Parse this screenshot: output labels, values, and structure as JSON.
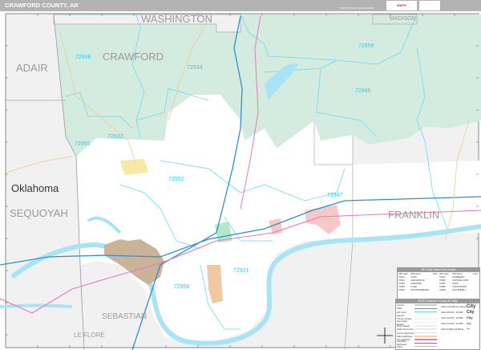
{
  "header": {
    "title": "CRAWFORD COUNTY, AR",
    "edition": "2020 ZIP Code Premium Edition",
    "logo": "Market MAPS"
  },
  "map": {
    "counties": {
      "washington": "WASHINGTON",
      "madison": "MADISON",
      "adair": "ADAIR",
      "crawford": "CRAWFORD",
      "sequoyah": "SEQUOYAH",
      "franklin": "FRANKLIN",
      "sebastian": "SEBASTIAN",
      "le_flore": "LE FLORE"
    },
    "state_label": "Oklahoma",
    "zip_labels": [
      "72948",
      "72934",
      "72932",
      "72955",
      "72952",
      "72959",
      "72946",
      "72947",
      "72921",
      "72956"
    ],
    "colors": {
      "forest": "#d4ecdf",
      "outside": "#f1f1f1",
      "water": "#a9e4f6",
      "interstate": "#2f8fd0",
      "us_highway": "#ee77bb",
      "zip_boundary": "#6fd8f0",
      "van_buren_city": "#c9b49a",
      "alma_city": "#f0c9a2",
      "mulberry_city": "#f6c8c8"
    }
  },
  "index": {
    "title": "ZIP Code Index/Grid Locator",
    "headers": [
      "ZIP Code",
      "ZIP Name",
      "Grid"
    ],
    "rows": [
      [
        "72921",
        "ALMA",
        ""
      ],
      [
        "72932",
        "CEDARVILLE",
        ""
      ],
      [
        "72934",
        "CHESTER",
        ""
      ],
      [
        "72935",
        "DYER",
        ""
      ],
      [
        "72946",
        "MOUNTAINBURG",
        ""
      ],
      [
        "72947",
        "MULBERRY",
        ""
      ],
      [
        "72948",
        "NATURAL DAM",
        ""
      ],
      [
        "72952",
        "RUDY",
        ""
      ],
      [
        "72955",
        "UNIONTOWN",
        ""
      ],
      [
        "72956",
        "VAN BUREN",
        ""
      ]
    ]
  },
  "legend": {
    "title": "2020 Crawford County, AR Map",
    "items": [
      {
        "label": "County",
        "color": "#cccccc"
      },
      {
        "label": "State",
        "color": "#888888"
      },
      {
        "label": "ZIP Code",
        "color": "#6fd8f0"
      },
      {
        "label": "Airports",
        "color": "#ffffff"
      },
      {
        "label": "Primary Roads",
        "color": "#eeeeee"
      },
      {
        "label": "Secondary Roads",
        "color": "#eeeeee"
      },
      {
        "label": "Minor Roads",
        "color": "#eeeeee"
      },
      {
        "label": "Indian Reserves",
        "color": "#fbe3e3"
      },
      {
        "label": "County Highways",
        "color": "#dddddd"
      },
      {
        "label": "State Highways",
        "color": "#f7d59a"
      },
      {
        "label": "US Highways",
        "color": "#ee77bb"
      },
      {
        "label": "Interstate Highways",
        "color": "#2f8fd0"
      },
      {
        "label": "Parks",
        "color": "#8fdc8f"
      }
    ],
    "cities": [
      "Cities 100,000 and Above",
      "Cities 50,000 - 99,999",
      "Cities 25,000 - 49,999",
      "Cities 10,000 - 24,999",
      "Cities 9,999 and Below"
    ],
    "city_sample": "City"
  }
}
